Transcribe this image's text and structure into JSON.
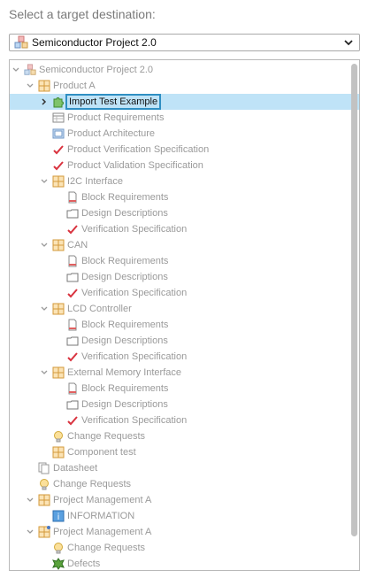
{
  "prompt": "Select a target destination:",
  "dropdown": {
    "value": "Semiconductor Project 2.0",
    "icon": "project-icon"
  },
  "tree": [
    {
      "label": "Semiconductor Project 2.0",
      "icon": "project",
      "depth": 0,
      "tw": "expanded"
    },
    {
      "label": "Product A",
      "icon": "grid",
      "depth": 1,
      "tw": "expanded"
    },
    {
      "label": "Import Test Example",
      "icon": "puzzle",
      "depth": 2,
      "tw": "collapsed",
      "selected": true
    },
    {
      "label": "Product Requirements",
      "icon": "table",
      "depth": 2,
      "tw": "none"
    },
    {
      "label": "Product Architecture",
      "icon": "arch",
      "depth": 2,
      "tw": "none"
    },
    {
      "label": "Product Verification Specification",
      "icon": "check",
      "depth": 2,
      "tw": "none"
    },
    {
      "label": "Product Validation Specification",
      "icon": "check",
      "depth": 2,
      "tw": "none"
    },
    {
      "label": "I2C Interface",
      "icon": "grid",
      "depth": 2,
      "tw": "expanded"
    },
    {
      "label": "Block Requirements",
      "icon": "doc",
      "depth": 3,
      "tw": "none"
    },
    {
      "label": "Design Descriptions",
      "icon": "folder",
      "depth": 3,
      "tw": "none"
    },
    {
      "label": "Verification Specification",
      "icon": "check",
      "depth": 3,
      "tw": "none"
    },
    {
      "label": "CAN",
      "icon": "grid",
      "depth": 2,
      "tw": "expanded"
    },
    {
      "label": "Block Requirements",
      "icon": "doc",
      "depth": 3,
      "tw": "none"
    },
    {
      "label": "Design Descriptions",
      "icon": "folder",
      "depth": 3,
      "tw": "none"
    },
    {
      "label": "Verification Specification",
      "icon": "check",
      "depth": 3,
      "tw": "none"
    },
    {
      "label": "LCD Controller",
      "icon": "grid",
      "depth": 2,
      "tw": "expanded"
    },
    {
      "label": "Block Requirements",
      "icon": "doc",
      "depth": 3,
      "tw": "none"
    },
    {
      "label": "Design Descriptions",
      "icon": "folder",
      "depth": 3,
      "tw": "none"
    },
    {
      "label": "Verification Specification",
      "icon": "check",
      "depth": 3,
      "tw": "none"
    },
    {
      "label": "External Memory Interface",
      "icon": "grid",
      "depth": 2,
      "tw": "expanded"
    },
    {
      "label": "Block Requirements",
      "icon": "doc",
      "depth": 3,
      "tw": "none"
    },
    {
      "label": "Design Descriptions",
      "icon": "folder",
      "depth": 3,
      "tw": "none"
    },
    {
      "label": "Verification Specification",
      "icon": "check",
      "depth": 3,
      "tw": "none"
    },
    {
      "label": "Change Requests",
      "icon": "bulb",
      "depth": 2,
      "tw": "none"
    },
    {
      "label": "Component test",
      "icon": "grid",
      "depth": 2,
      "tw": "none"
    },
    {
      "label": "Datasheet",
      "icon": "pages",
      "depth": 1,
      "tw": "none"
    },
    {
      "label": "Change Requests",
      "icon": "bulb",
      "depth": 1,
      "tw": "none"
    },
    {
      "label": "Project Management A",
      "icon": "grid",
      "depth": 1,
      "tw": "expanded"
    },
    {
      "label": "INFORMATION",
      "icon": "info",
      "depth": 2,
      "tw": "none"
    },
    {
      "label": "Project Management A",
      "icon": "grid-dot",
      "depth": 1,
      "tw": "expanded"
    },
    {
      "label": "Change Requests",
      "icon": "bulb",
      "depth": 2,
      "tw": "none"
    },
    {
      "label": "Defects",
      "icon": "bug",
      "depth": 2,
      "tw": "none"
    }
  ]
}
